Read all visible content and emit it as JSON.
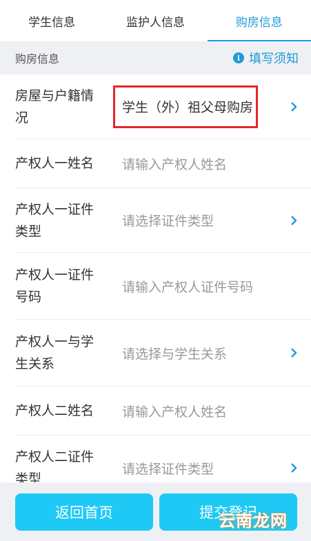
{
  "tabs": [
    {
      "label": "学生信息",
      "active": false
    },
    {
      "label": "监护人信息",
      "active": false
    },
    {
      "label": "购房信息",
      "active": true
    }
  ],
  "section": {
    "title": "购房信息",
    "notice_label": "填写须知",
    "notice_icon": "info-icon"
  },
  "rows": [
    {
      "label": "房屋与户籍情况",
      "value": "学生（外）祖父母购房",
      "type": "select",
      "filled": true
    },
    {
      "label": "产权人一姓名",
      "value": "请输入产权人姓名",
      "type": "input",
      "filled": false
    },
    {
      "label": "产权人一证件类型",
      "value": "请选择证件类型",
      "type": "select",
      "filled": false
    },
    {
      "label": "产权人一证件号码",
      "value": "请输入产权人证件号码",
      "type": "input",
      "filled": false
    },
    {
      "label": "产权人一与学生关系",
      "value": "请选择与学生关系",
      "type": "select",
      "filled": false
    },
    {
      "label": "产权人二姓名",
      "value": "请输入产权人姓名",
      "type": "input",
      "filled": false
    },
    {
      "label": "产权人二证件类型",
      "value": "请选择证件类型",
      "type": "select",
      "filled": false
    }
  ],
  "footer": {
    "back_label": "返回首页",
    "submit_label": "提交登记"
  },
  "watermark": "云南龙网",
  "colors": {
    "accent": "#1e9bd7",
    "button": "#1ec9f6",
    "highlight": "#e4252b",
    "section_bg": "#eef0f3"
  }
}
